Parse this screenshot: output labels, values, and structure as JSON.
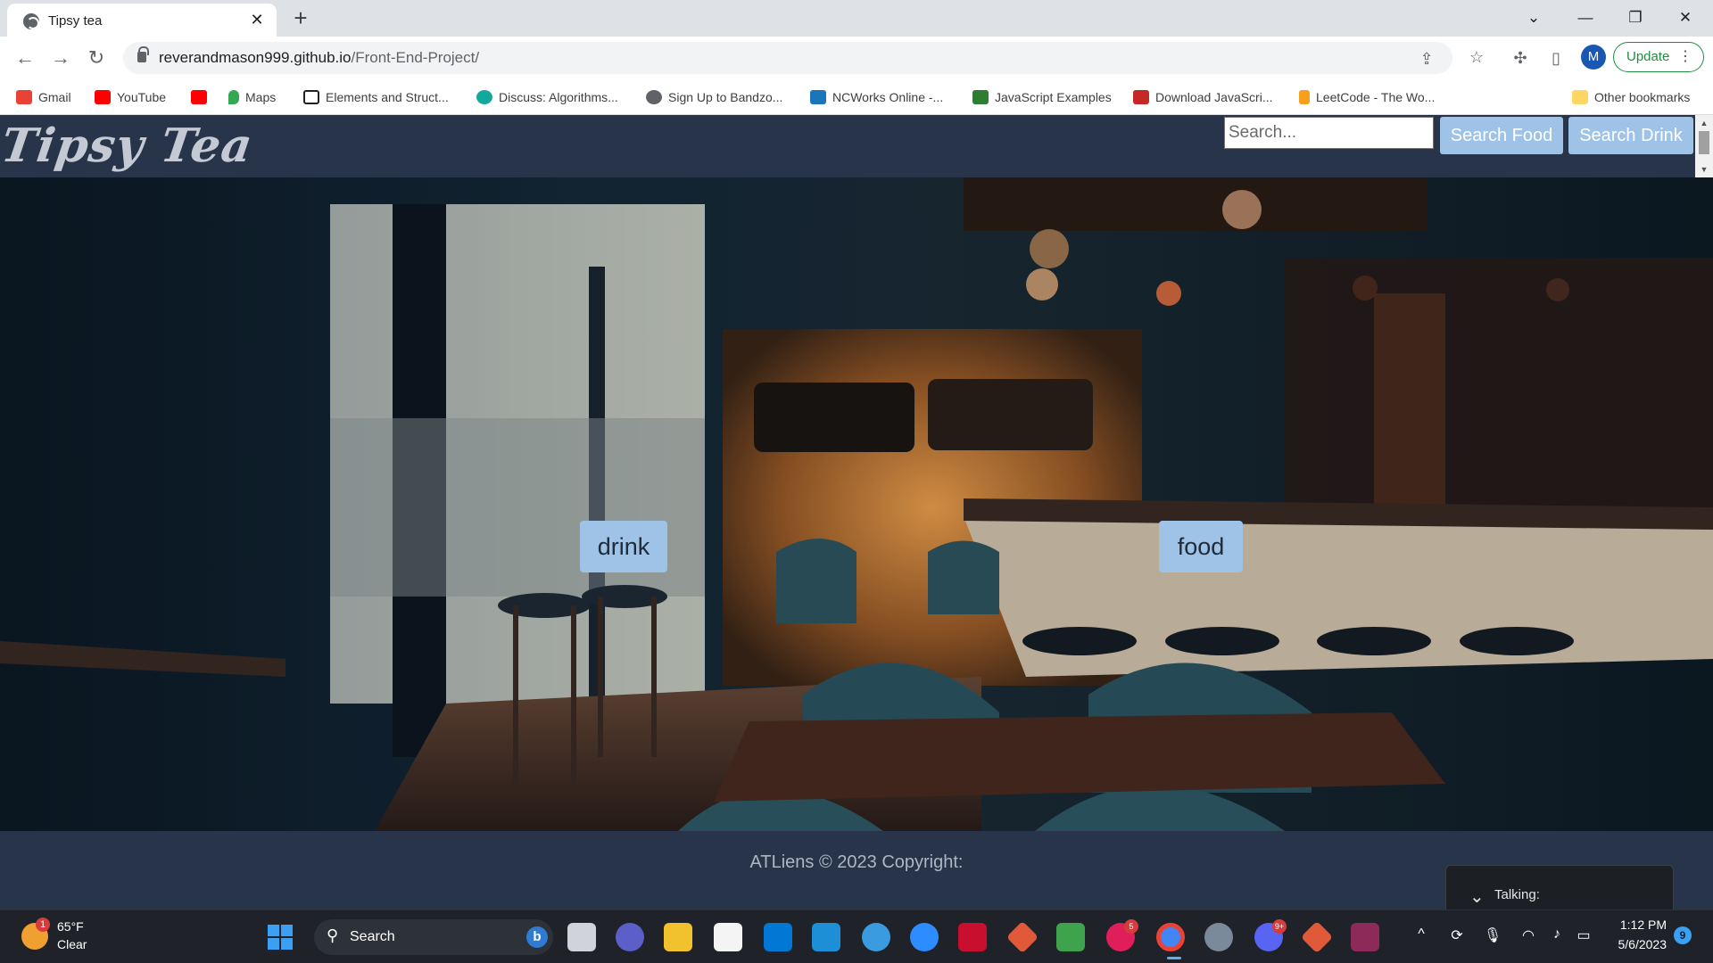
{
  "browser": {
    "tab_title": "Tipsy tea",
    "url_host": "reverandmason999.github.io",
    "url_path": "/Front-End-Project/",
    "profile_initial": "M",
    "update_label": "Update"
  },
  "bookmarks": [
    {
      "label": "Gmail",
      "color": "#ea4335"
    },
    {
      "label": "YouTube",
      "color": "#ff0000"
    },
    {
      "label": "",
      "color": "#ff0000"
    },
    {
      "label": "Maps",
      "color": "#34a853"
    },
    {
      "label": "Elements and Struct...",
      "color": "#202124"
    },
    {
      "label": "Discuss: Algorithms...",
      "color": "#13a89e"
    },
    {
      "label": "Sign Up to Bandzo...",
      "color": "#5f6368"
    },
    {
      "label": "NCWorks Online -...",
      "color": "#1b75bb"
    },
    {
      "label": "JavaScript Examples",
      "color": "#2e7d32"
    },
    {
      "label": "Download JavaScri...",
      "color": "#c62828"
    },
    {
      "label": "LeetCode - The Wo...",
      "color": "#f89f1b"
    },
    {
      "label": "Other bookmarks",
      "color": "#fdd663"
    }
  ],
  "site": {
    "logo": "Tipsy Tea",
    "search_placeholder": "Search...",
    "search_food_label": "Search Food",
    "search_drink_label": "Search Drink",
    "drink_label": "drink",
    "food_label": "food",
    "footer_text": "ATLiens © 2023 Copyright:"
  },
  "overlay": {
    "talking_label": "Talking:"
  },
  "taskbar": {
    "weather_temp": "65°F",
    "weather_condition": "Clear",
    "weather_badge": "1",
    "search_label": "Search",
    "slack_badge": "5",
    "discord_badge": "9+",
    "time": "1:12 PM",
    "date": "5/6/2023",
    "notification_count": "9"
  },
  "colors": {
    "header_bg": "#27344a",
    "accent_button": "#9ec3e6",
    "footer_text": "#aeb6c2"
  }
}
